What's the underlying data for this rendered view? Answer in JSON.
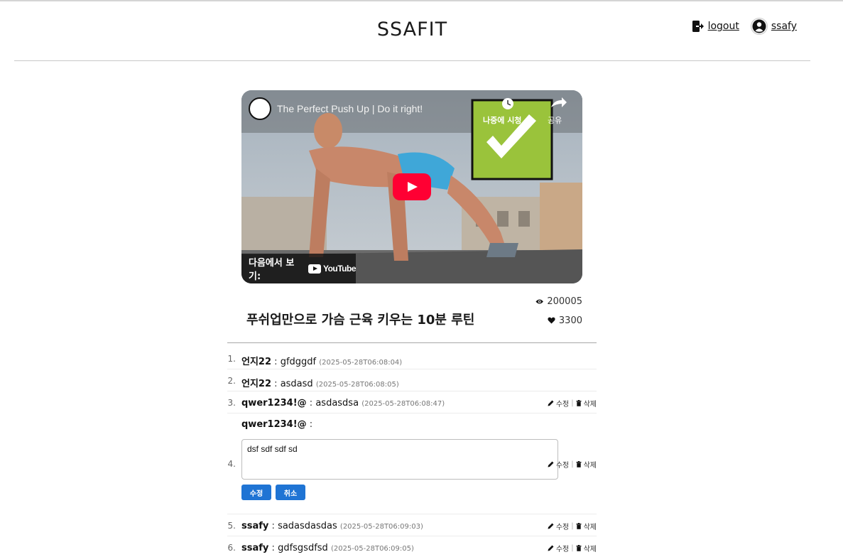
{
  "header": {
    "brand": "SSAFIT",
    "logout_label": "logout",
    "user_label": "ssafy"
  },
  "video": {
    "title": "The Perfect Push Up | Do it right!",
    "watch_later_label": "나중에 시청",
    "share_label": "공유",
    "watch_on_label": "다음에서 보기:",
    "youtube_label": "YouTube",
    "page_title": "푸쉬업만으로 가슴 근육 키우는 10분 루틴",
    "views": "200005",
    "likes": "3300"
  },
  "comments": [
    {
      "num": "1.",
      "author": "언지22",
      "sep": ":",
      "text": "gfdggdf",
      "time": "(2025-05-28T06:08:04)"
    },
    {
      "num": "2.",
      "author": "언지22",
      "sep": ":",
      "text": "asdasd",
      "time": "(2025-05-28T06:08:05)"
    },
    {
      "num": "3.",
      "author": "qwer1234!@",
      "sep": ":",
      "text": "asdasdsa",
      "time": "(2025-05-28T06:08:47)"
    },
    {
      "num": "4.",
      "author": "qwer1234!@",
      "sep": ":",
      "edit_value": "dsf sdf sdf sd",
      "save_label": "수정",
      "cancel_label": "취소"
    },
    {
      "num": "5.",
      "author": "ssafy",
      "sep": ":",
      "text": "sadasdasdas",
      "time": "(2025-05-28T06:09:03)"
    },
    {
      "num": "6.",
      "author": "ssafy",
      "sep": ":",
      "text": "gdfsgsdfsd",
      "time": "(2025-05-28T06:09:05)"
    }
  ],
  "actions": {
    "edit_label": "수정",
    "delete_label": "삭제",
    "divider": "|"
  },
  "icons": {
    "logout": "logout-icon",
    "user": "user-circle-icon",
    "views": "eye-icon",
    "likes": "heart-icon",
    "edit": "pencil-icon",
    "delete": "trash-icon"
  },
  "colors": {
    "primary_button": "#1f74d4",
    "play_button": "#ff0033",
    "checkmark_overlay": "#9ac33b"
  }
}
